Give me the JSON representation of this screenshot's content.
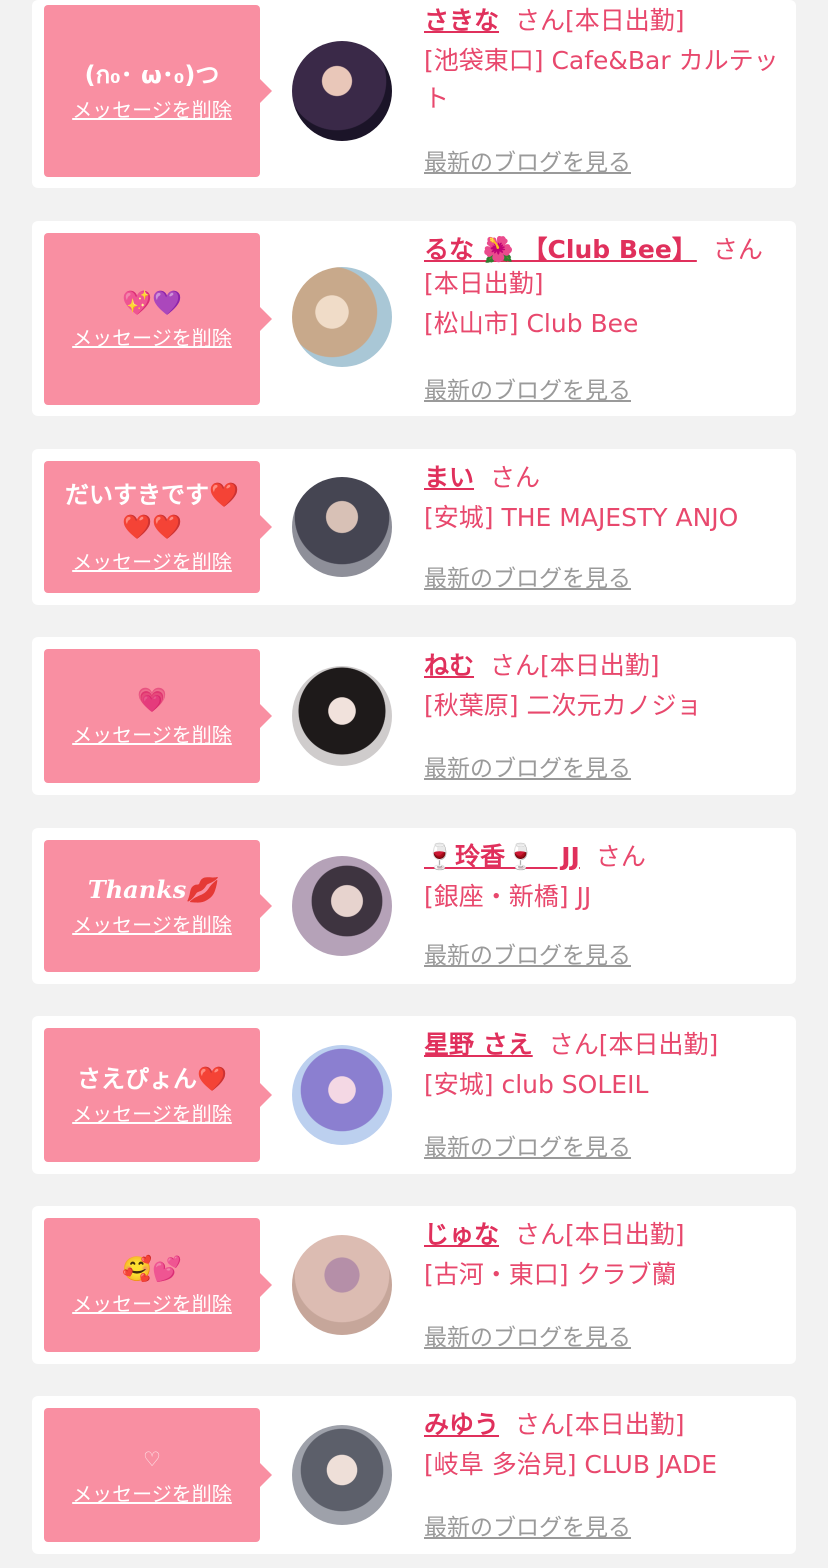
{
  "labels": {
    "delete_message": "メッセージを削除",
    "view_blog": "最新のブログを見る",
    "san": "さん"
  },
  "entries": [
    {
      "name": "さきな",
      "shift": "[本日出勤]",
      "shop": "[池袋東口] Cafe&Bar カルテット",
      "message": "(ก₀･ ω･₀)つ",
      "avatar_color": "#2b1e3a"
    },
    {
      "name": "るな 🌺 【Club Bee】",
      "shift": "[本日出勤]",
      "shop": "[松山市] Club Bee",
      "message": "💖💜",
      "avatar_color": "#c7b9a3"
    },
    {
      "name": "まい",
      "shift": "",
      "shop": "[安城] THE MAJESTY ANJO",
      "message": "だいすきです❤️❤️❤️",
      "avatar_color": "#6b6c78"
    },
    {
      "name": "ねむ",
      "shift": "[本日出勤]",
      "shop": "[秋葉原] 二次元カノジョ",
      "message": "💗",
      "avatar_color": "#3a3232"
    },
    {
      "name": "🍷玲香🍷　JJ",
      "shift": "",
      "shop": "[銀座・新橋] JJ",
      "message": "Thanks💋",
      "avatar_color": "#b8a3b6"
    },
    {
      "name": "星野 さえ",
      "shift": "[本日出勤]",
      "shop": "[安城] club SOLEIL",
      "message": "さえぴょん❤️",
      "avatar_color": "#9fa6d6"
    },
    {
      "name": "じゅな",
      "shift": "[本日出勤]",
      "shop": "[古河・東口] クラブ蘭",
      "message": "🥰💕",
      "avatar_color": "#d9b3a8"
    },
    {
      "name": "みゆう",
      "shift": "[本日出勤]",
      "shop": "[岐阜 多治見] CLUB JADE",
      "message": "♡",
      "avatar_color": "#7a7d88"
    }
  ]
}
